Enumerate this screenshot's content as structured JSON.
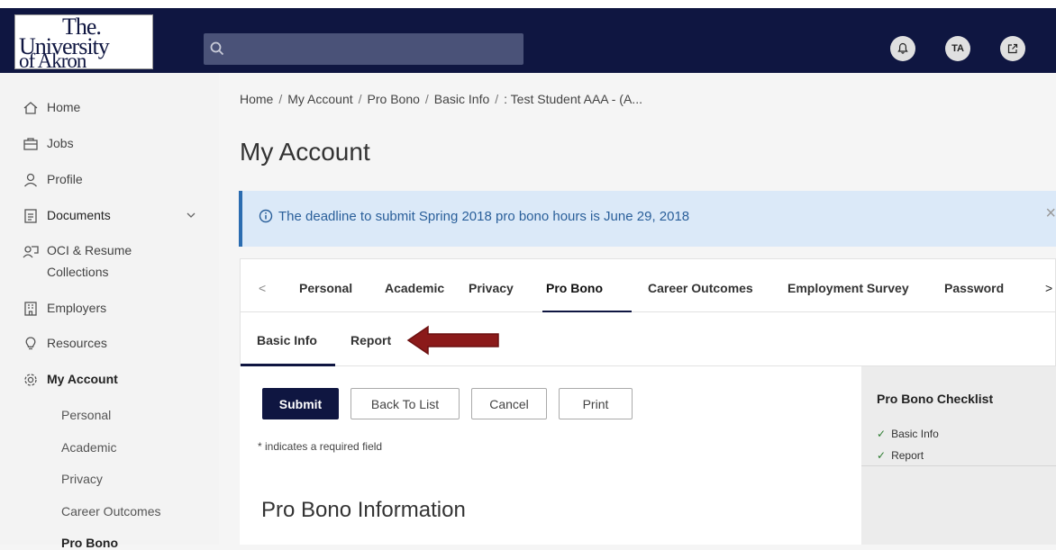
{
  "header": {
    "logo_line1": "The.",
    "logo_line2": "University",
    "logo_line3": "of Akron",
    "search_placeholder": "",
    "avatar_initials": "TA"
  },
  "sidebar": {
    "items": [
      {
        "label": "Home",
        "icon": "home-icon"
      },
      {
        "label": "Jobs",
        "icon": "briefcase-icon"
      },
      {
        "label": "Profile",
        "icon": "profile-icon"
      },
      {
        "label": "Documents",
        "icon": "documents-icon"
      },
      {
        "label": "OCI & Resume",
        "label2": "Collections",
        "icon": "collections-icon"
      },
      {
        "label": "Employers",
        "icon": "employers-icon"
      },
      {
        "label": "Resources",
        "icon": "resources-icon"
      },
      {
        "label": "My Account",
        "icon": "gear-icon"
      }
    ],
    "sub_items": [
      "Personal",
      "Academic",
      "Privacy",
      "Career Outcomes",
      "Pro Bono"
    ]
  },
  "breadcrumb": [
    "Home",
    "My Account",
    "Pro Bono",
    "Basic Info",
    ": Test Student AAA - (A..."
  ],
  "page_title": "My Account",
  "alert": {
    "text": "The deadline to submit Spring 2018 pro bono hours is  June 29, 2018",
    "close": "×"
  },
  "tabs": {
    "prev": "<",
    "next": ">",
    "items": [
      "Personal",
      "Academic",
      "Privacy",
      "Pro Bono",
      "Career Outcomes",
      "Employment Survey",
      "Password"
    ],
    "active": "Pro Bono"
  },
  "subtabs": {
    "items": [
      "Basic Info",
      "Report"
    ],
    "active": "Basic Info"
  },
  "actions": {
    "submit": "Submit",
    "back": "Back To List",
    "cancel": "Cancel",
    "print": "Print"
  },
  "required_note": "* indicates a required field",
  "section_title": "Pro Bono Information",
  "checklist": {
    "title": "Pro Bono Checklist",
    "items": [
      "Basic Info",
      "Report"
    ],
    "check": "✓"
  },
  "colors": {
    "header_bg": "#0f1641",
    "alert_bg": "#dbe9f8",
    "alert_text": "#2a5f9a",
    "arrow": "#8b1a1a",
    "check": "#2e7d32"
  }
}
